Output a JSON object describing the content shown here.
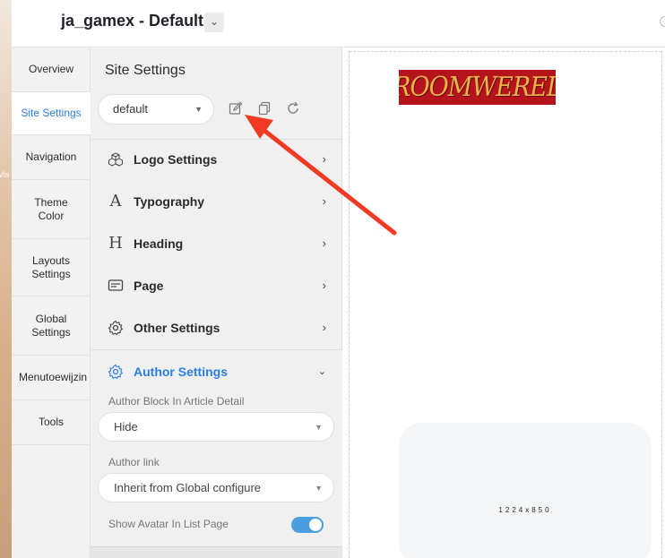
{
  "header": {
    "title": "ja_gamex - Default",
    "dropdown_icon": "chevron-down-icon"
  },
  "background": {
    "clipped_text": "Vis"
  },
  "nav": {
    "items": [
      {
        "label": "Overview"
      },
      {
        "label": "Site Settings",
        "active": true
      },
      {
        "label": "Navigation"
      },
      {
        "label": "Theme\nColor"
      },
      {
        "label": "Layouts\nSettings"
      },
      {
        "label": "Global\nSettings"
      },
      {
        "label": "Menutoewijzin"
      },
      {
        "label": "Tools"
      }
    ]
  },
  "panel": {
    "title": "Site Settings",
    "preset": {
      "value": "default"
    },
    "tools": [
      "edit-icon",
      "copy-icon",
      "refresh-icon"
    ],
    "sections": [
      {
        "label": "Logo Settings",
        "icon": "cubes-icon"
      },
      {
        "label": "Typography",
        "icon": "font-icon"
      },
      {
        "label": "Heading",
        "icon": "heading-icon"
      },
      {
        "label": "Page",
        "icon": "page-icon"
      },
      {
        "label": "Other Settings",
        "icon": "gear-icon"
      }
    ],
    "author": {
      "label": "Author Settings",
      "icon": "gear-icon",
      "block_label": "Author Block In Article Detail",
      "block_value": "Hide",
      "link_label": "Author link",
      "link_value": "Inherit from Global configure",
      "avatar_label": "Show Avatar In List Page",
      "avatar_enabled": true
    }
  },
  "preview": {
    "logo_text": "DROOMWERELD",
    "placeholder_size": "1224x850"
  },
  "colors": {
    "accent": "#2a7de1",
    "toggle": "#4a9ee0",
    "logo_bg": "#b5141c",
    "logo_text": "#e7b24a",
    "annotation": "#f03a23"
  }
}
